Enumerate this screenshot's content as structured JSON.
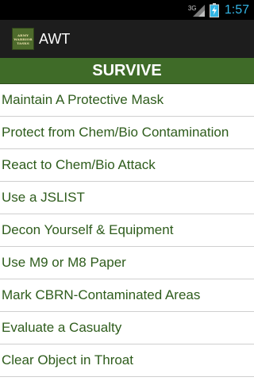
{
  "status_bar": {
    "network": "3G",
    "time": "1:57",
    "icons": [
      "signal-icon",
      "battery-charging-icon"
    ]
  },
  "action_bar": {
    "app_icon_text": [
      "ARMY",
      "WARRIOR",
      "TASKS"
    ],
    "title": "AWT"
  },
  "section": {
    "title": "SURVIVE"
  },
  "tasks": [
    "Maintain A Protective Mask",
    "Protect from Chem/Bio Contamination",
    "React to Chem/Bio Attack",
    "Use a JSLIST",
    "Decon Yourself & Equipment",
    "Use M9 or M8 Paper",
    "Mark CBRN-Contaminated Areas",
    "Evaluate a Casualty",
    "Clear Object in Throat"
  ],
  "colors": {
    "header_green": "#3f6b28",
    "item_text": "#2e5c1c",
    "clock": "#33b5e5"
  }
}
